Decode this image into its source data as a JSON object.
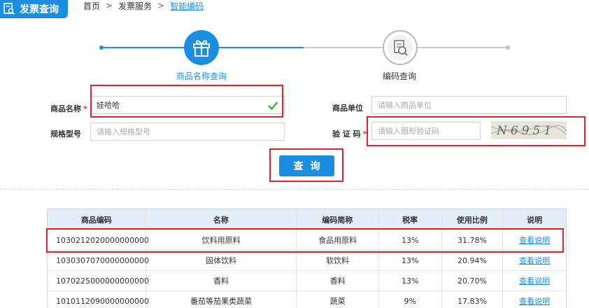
{
  "header": {
    "module_title": "发票查询",
    "breadcrumb": {
      "home": "首页",
      "separator": ">",
      "section": "发票服务",
      "current": "智能编码"
    }
  },
  "steps": [
    {
      "label": "商品名称查询",
      "icon": "gift-icon",
      "state": "active"
    },
    {
      "label": "编码查询",
      "icon": "document-search-icon",
      "state": "inactive"
    }
  ],
  "form": {
    "product_name": {
      "label": "商品名称",
      "required": "*",
      "value": "娃哈哈"
    },
    "spec_model": {
      "label": "规格型号",
      "placeholder": "请输入规格型号"
    },
    "product_unit": {
      "label": "商品单位",
      "placeholder": "请输入商品单位"
    },
    "captcha": {
      "label": "验 证 码",
      "required": "*",
      "placeholder": "请输入图形验证码",
      "image_text": "N6951"
    },
    "query_button": "查询"
  },
  "table": {
    "headers": [
      "商品编码",
      "名称",
      "编码简称",
      "税率",
      "使用比例",
      "说明"
    ],
    "rows": [
      [
        "1030212020000000000",
        "饮料用原料",
        "食品用原料",
        "13%",
        "31.78%",
        "查看说明"
      ],
      [
        "1030307070000000000",
        "固体饮料",
        "软饮料",
        "13%",
        "20.94%",
        "查看说明"
      ],
      [
        "1070225000000000000",
        "香料",
        "香料",
        "13%",
        "20.70%",
        "查看说明"
      ],
      [
        "1010112090000000000",
        "番茄等茄果类蔬菜",
        "蔬菜",
        "9%",
        "17.83%",
        "查看说明"
      ]
    ]
  },
  "colors": {
    "accent": "#1a8ee0",
    "highlight": "#d62828",
    "success": "#3cb034"
  }
}
